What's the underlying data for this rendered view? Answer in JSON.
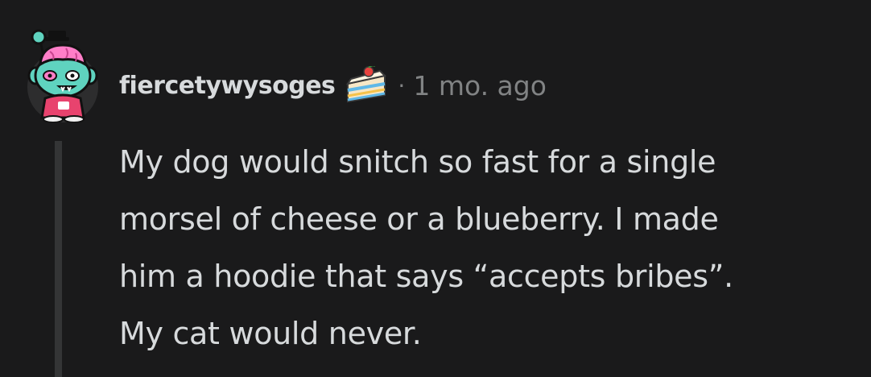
{
  "comment": {
    "username": "fiercetywysoges",
    "separator": "·",
    "timestamp": "1 mo. ago",
    "body_lines": [
      "My dog would snitch so fast for a single",
      "morsel of cheese or a blueberry. I made",
      "him a hoodie that says “accepts bribes”.",
      "My cat would never."
    ],
    "avatar_icon": "snoo-zombie-avatar",
    "flair_icon": "cake-slice-icon"
  },
  "colors": {
    "background": "#1a1a1b",
    "text": "#d7dadc",
    "meta": "#818384",
    "thread_line": "#343536"
  }
}
